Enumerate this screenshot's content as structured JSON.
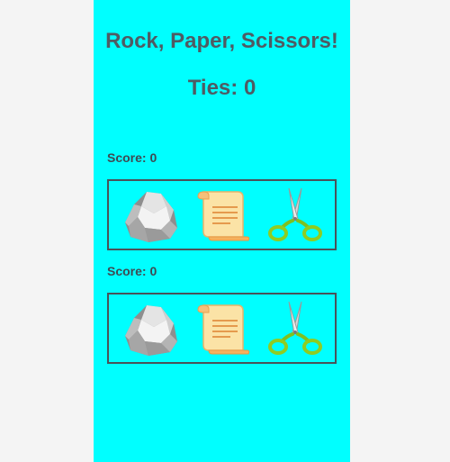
{
  "title": "Rock, Paper, Scissors!",
  "ties": "Ties: 0",
  "players": [
    {
      "score": "Score: 0",
      "choices": [
        {
          "name": "rock",
          "icon": "rock-icon"
        },
        {
          "name": "paper",
          "icon": "paper-scroll-icon"
        },
        {
          "name": "scissors",
          "icon": "scissors-icon"
        }
      ]
    },
    {
      "score": "Score: 0",
      "choices": [
        {
          "name": "rock",
          "icon": "rock-icon"
        },
        {
          "name": "paper",
          "icon": "paper-scroll-icon"
        },
        {
          "name": "scissors",
          "icon": "scissors-icon"
        }
      ]
    }
  ],
  "colors": {
    "background": "#f4f4f4",
    "panel": "#00ffff",
    "text": "#4f5b63",
    "border": "#4a5258"
  }
}
